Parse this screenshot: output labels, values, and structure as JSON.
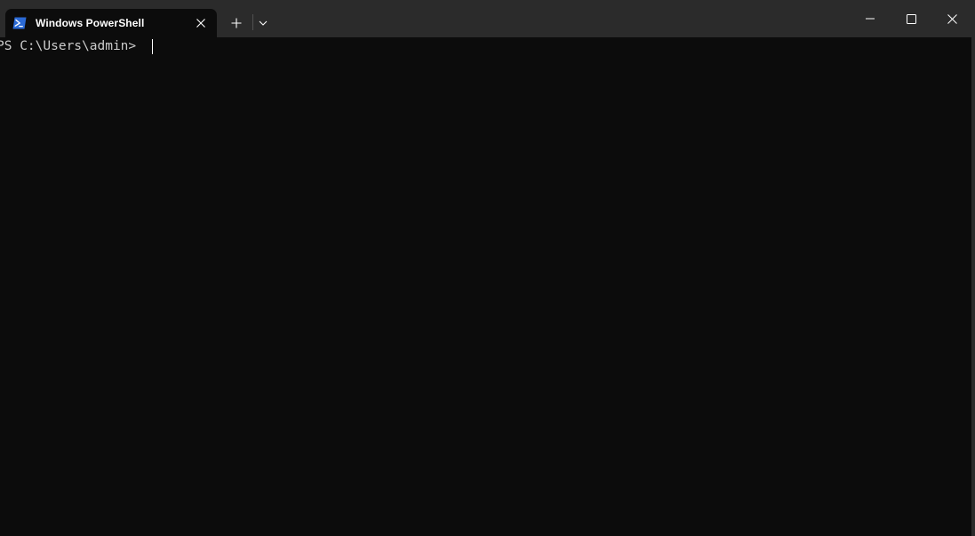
{
  "window": {
    "colors": {
      "titlebar": "#2b2b2b",
      "terminal_bg": "#0c0c0c",
      "text": "#cccccc",
      "powershell_icon_blue": "#2b6ad6"
    }
  },
  "tabs": [
    {
      "title": "Windows PowerShell",
      "icon": "powershell-icon",
      "active": true
    }
  ],
  "toolbar": {
    "new_tab_icon": "plus-icon",
    "dropdown_icon": "chevron-down-icon"
  },
  "caption": {
    "minimize_icon": "minimize-icon",
    "maximize_icon": "maximize-icon",
    "close_icon": "close-icon"
  },
  "terminal": {
    "prompt": "PS C:\\Users\\admin> "
  }
}
